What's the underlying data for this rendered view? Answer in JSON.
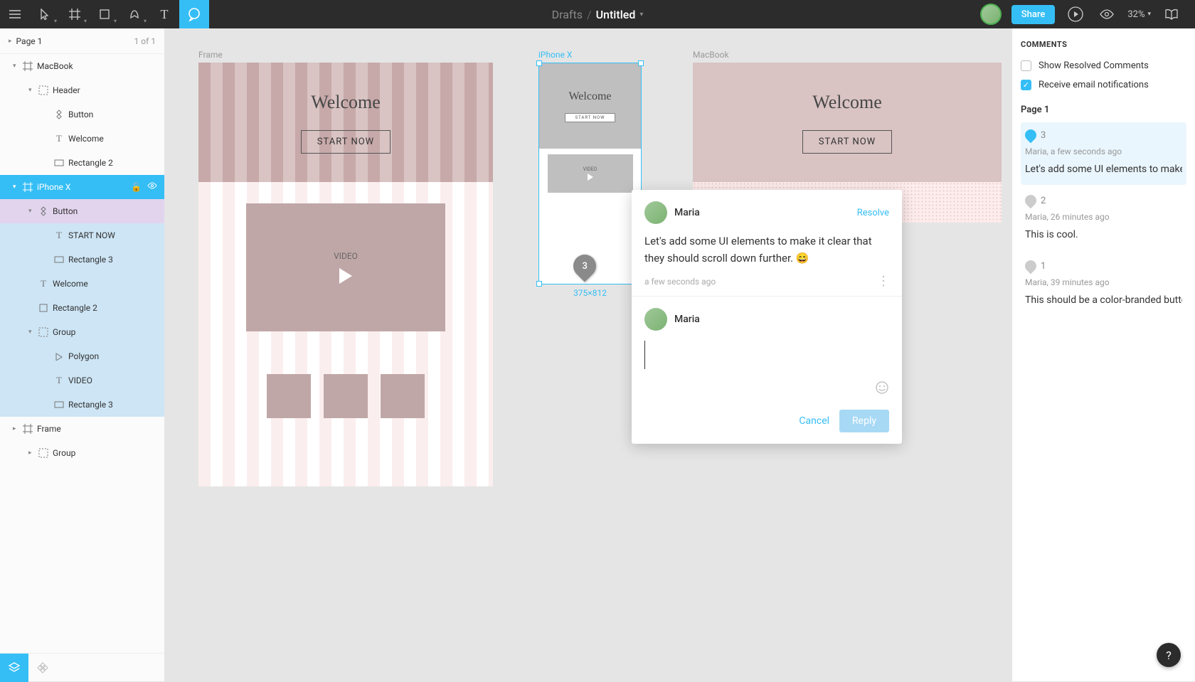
{
  "toolbar": {
    "breadcrumb_root": "Drafts",
    "doc_title": "Untitled",
    "share_label": "Share",
    "zoom": "32%"
  },
  "pages": {
    "current": "Page 1",
    "count": "1 of 1"
  },
  "layers": [
    {
      "label": "MacBook",
      "depth": 1,
      "icon": "frame",
      "caret": "down"
    },
    {
      "label": "Header",
      "depth": 2,
      "icon": "group",
      "caret": "down"
    },
    {
      "label": "Button",
      "depth": 3,
      "icon": "component",
      "caret": ""
    },
    {
      "label": "Welcome",
      "depth": 3,
      "icon": "text",
      "caret": ""
    },
    {
      "label": "Rectangle 2",
      "depth": 3,
      "icon": "rect",
      "caret": ""
    },
    {
      "label": "iPhone X",
      "depth": 1,
      "icon": "frame",
      "caret": "down",
      "state": "selected"
    },
    {
      "label": "Button",
      "depth": 2,
      "icon": "component",
      "caret": "down",
      "state": "child"
    },
    {
      "label": "START NOW",
      "depth": 3,
      "icon": "text",
      "caret": "",
      "state": "grand"
    },
    {
      "label": "Rectangle 3",
      "depth": 3,
      "icon": "rect",
      "caret": "",
      "state": "grand"
    },
    {
      "label": "Welcome",
      "depth": 2,
      "icon": "text",
      "caret": "",
      "state": "grand"
    },
    {
      "label": "Rectangle 2",
      "depth": 2,
      "icon": "square",
      "caret": "",
      "state": "grand"
    },
    {
      "label": "Group",
      "depth": 2,
      "icon": "group",
      "caret": "down",
      "state": "grand"
    },
    {
      "label": "Polygon",
      "depth": 3,
      "icon": "polygon",
      "caret": "",
      "state": "grand"
    },
    {
      "label": "VIDEO",
      "depth": 3,
      "icon": "text",
      "caret": "",
      "state": "grand"
    },
    {
      "label": "Rectangle 3",
      "depth": 3,
      "icon": "rect",
      "caret": "",
      "state": "grand"
    },
    {
      "label": "Frame",
      "depth": 1,
      "icon": "frame",
      "caret": "right"
    },
    {
      "label": "Group",
      "depth": 2,
      "icon": "group",
      "caret": "right"
    }
  ],
  "canvas": {
    "frame1_label": "Frame",
    "frame2_label": "iPhone X",
    "frame3_label": "MacBook",
    "welcome": "Welcome",
    "start": "START NOW",
    "video": "VIDEO",
    "selection_dims": "375×812",
    "pin_number": "3"
  },
  "comment_popup": {
    "author": "Maria",
    "resolve": "Resolve",
    "text": "Let's add some UI elements to make it clear that they should scroll down further. 😄",
    "time": "a few seconds ago",
    "reply_author": "Maria",
    "cancel": "Cancel",
    "reply": "Reply"
  },
  "comments_panel": {
    "title": "COMMENTS",
    "show_resolved": "Show Resolved Comments",
    "email_notif": "Receive email notifications",
    "page_label": "Page 1",
    "items": [
      {
        "num": "3",
        "meta": "Maria, a few seconds ago",
        "text": "Let's add some UI elements to make it",
        "active": true
      },
      {
        "num": "2",
        "meta": "Maria, 26 minutes ago",
        "text": "This is cool.",
        "active": false
      },
      {
        "num": "1",
        "meta": "Maria, 39 minutes ago",
        "text": "This should be a color-branded button",
        "active": false
      }
    ]
  },
  "help": "?"
}
